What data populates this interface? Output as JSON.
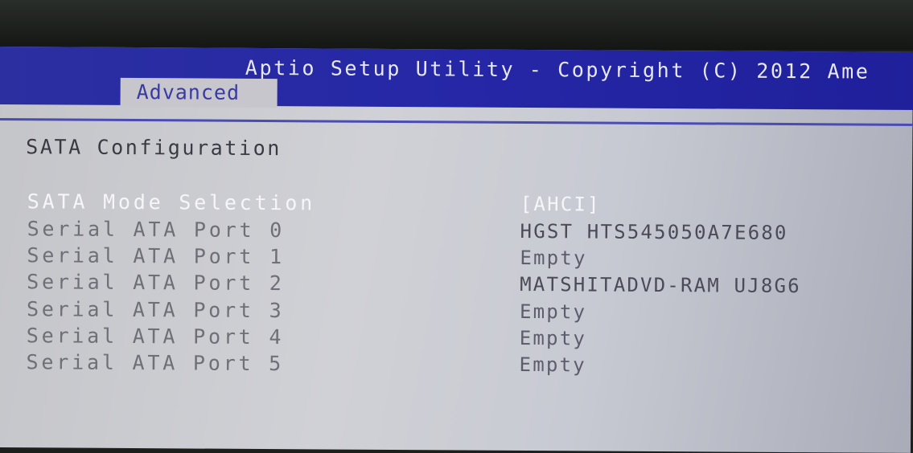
{
  "header": {
    "title": "Aptio Setup Utility - Copyright (C) 2012 Ame",
    "active_tab": "Advanced"
  },
  "page": {
    "section_title": "SATA Configuration"
  },
  "settings": [
    {
      "label": "SATA Mode Selection",
      "value": "[AHCI]",
      "selected": true
    },
    {
      "label": "Serial ATA Port 0",
      "value": "HGST HTS545050A7E680"
    },
    {
      "label": "Serial ATA Port 1",
      "value": "Empty"
    },
    {
      "label": "Serial ATA Port 2",
      "value": "MATSHITADVD-RAM UJ8G6"
    },
    {
      "label": "Serial ATA Port 3",
      "value": "Empty"
    },
    {
      "label": "Serial ATA Port 4",
      "value": "Empty"
    },
    {
      "label": "Serial ATA Port 5",
      "value": "Empty"
    }
  ],
  "colors": {
    "header_blue": "#2527a6",
    "panel_gray": "#c6c6cc",
    "highlight_text": "#f6f6fa",
    "tab_text": "#3a3aa0"
  }
}
